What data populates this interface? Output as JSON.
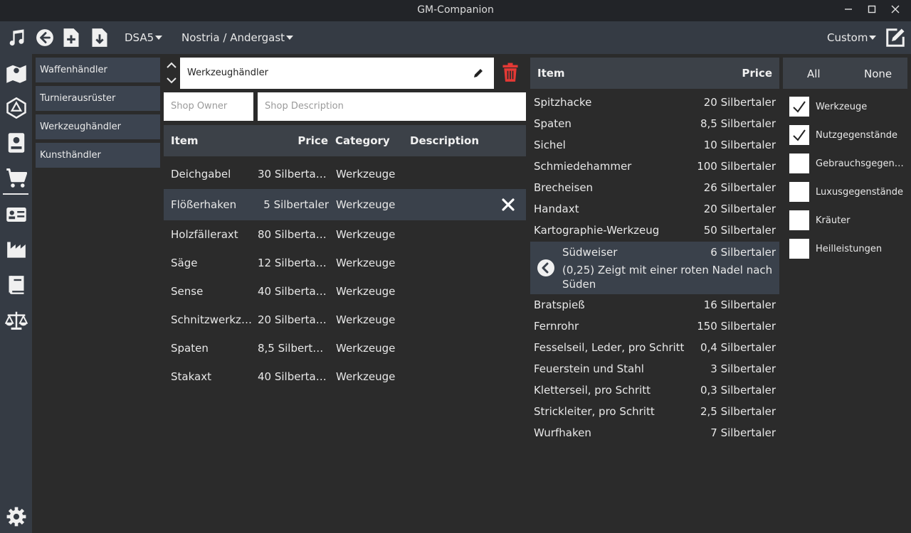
{
  "window": {
    "title": "GM-Companion"
  },
  "toolbar": {
    "system_label": "DSA5",
    "location_label": "Nostria / Andergast",
    "custom_label": "Custom"
  },
  "shops": [
    "Waffenhändler",
    "Turnierausrüster",
    "Werkzeughändler",
    "Kunsthändler"
  ],
  "shop_editor": {
    "shop_name": "Werkzeughändler",
    "owner_placeholder": "Shop Owner",
    "description_placeholder": "Shop Description",
    "columns": {
      "item": "Item",
      "price": "Price",
      "category": "Category",
      "description": "Description"
    },
    "rows": [
      {
        "item": "Deichgabel",
        "price": "30 Silbertal...",
        "category": "Werkzeuge"
      },
      {
        "item": "Flößerhaken",
        "price": "5 Silbertaler",
        "category": "Werkzeuge"
      },
      {
        "item": "Holzfälleraxt",
        "price": "80 Silbertal...",
        "category": "Werkzeuge"
      },
      {
        "item": "Säge",
        "price": "12 Silbertaler",
        "category": "Werkzeuge"
      },
      {
        "item": "Sense",
        "price": "40 Silbertal...",
        "category": "Werkzeuge"
      },
      {
        "item": "Schnitzwerkze...",
        "price": "20 Silbertal...",
        "category": "Werkzeuge"
      },
      {
        "item": "Spaten",
        "price": "8,5 Silberta...",
        "category": "Werkzeuge"
      },
      {
        "item": "Stakaxt",
        "price": "40 Silbertal...",
        "category": "Werkzeuge"
      }
    ]
  },
  "item_list": {
    "columns": {
      "item": "Item",
      "price": "Price"
    },
    "items_before": [
      {
        "name": "Spitzhacke",
        "price": "20 Silbertaler"
      },
      {
        "name": "Spaten",
        "price": "8,5 Silbertaler"
      },
      {
        "name": "Sichel",
        "price": "10 Silbertaler"
      },
      {
        "name": "Schmiedehammer",
        "price": "100 Silbertaler"
      },
      {
        "name": "Brecheisen",
        "price": "26 Silbertaler"
      },
      {
        "name": "Handaxt",
        "price": "20 Silbertaler"
      },
      {
        "name": "Kartographie-Werkzeug",
        "price": "50 Silbertaler"
      }
    ],
    "selected": {
      "name": "Südweiser",
      "price": "6 Silbertaler",
      "description_line1": "(0,25) Zeigt mit einer roten Nadel nach",
      "description_line2": "Süden"
    },
    "items_after": [
      {
        "name": "Bratspieß",
        "price": "16 Silbertaler"
      },
      {
        "name": "Fernrohr",
        "price": "150 Silbertaler"
      },
      {
        "name": "Fesselseil, Leder, pro Schritt",
        "price": "0,4 Silbertaler"
      },
      {
        "name": "Feuerstein und Stahl",
        "price": "3 Silbertaler"
      },
      {
        "name": "Kletterseil, pro Schritt",
        "price": "0,3 Silbertaler"
      },
      {
        "name": "Strickleiter, pro Schritt",
        "price": "2,5 Silbertaler"
      },
      {
        "name": "Wurfhaken",
        "price": "7 Silbertaler"
      }
    ]
  },
  "filter": {
    "all_label": "All",
    "none_label": "None",
    "categories": [
      {
        "label": "Werkzeuge",
        "checked": true
      },
      {
        "label": "Nutzgegenstände",
        "checked": true
      },
      {
        "label": "Gebrauchsgegenstä...",
        "checked": false
      },
      {
        "label": "Luxusgegenstände",
        "checked": false
      },
      {
        "label": "Kräuter",
        "checked": false
      },
      {
        "label": "Heilleistungen",
        "checked": false
      }
    ]
  },
  "colors": {
    "accent_delete": "#e53935",
    "panel": "#353b44",
    "background": "#2b2b2b"
  }
}
